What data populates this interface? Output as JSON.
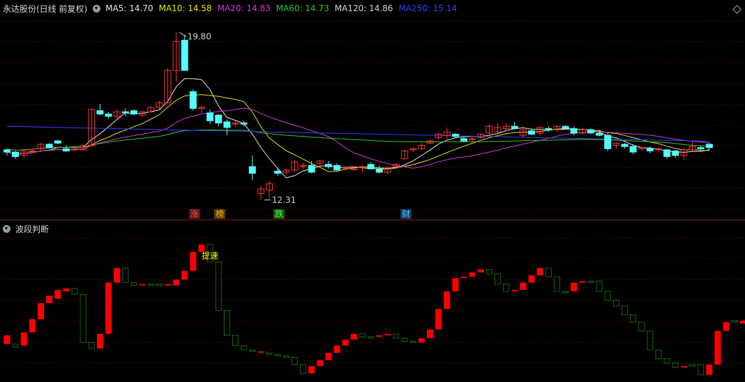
{
  "price_panel": {
    "title": "永达股份(日线 前复权)",
    "ma_legend": [
      {
        "label": "MA5: 14.70",
        "color": "#e8e8e8"
      },
      {
        "label": "MA10: 14.58",
        "color": "#e8e800"
      },
      {
        "label": "MA20: 14.83",
        "color": "#d23cd2"
      },
      {
        "label": "MA60: 14.73",
        "color": "#32c832"
      },
      {
        "label": "MA120: 14.86",
        "color": "#d8d8d8"
      },
      {
        "label": "MA250: 15.14",
        "color": "#3c3cff"
      }
    ],
    "high_label": "19.80",
    "low_label": "12.31",
    "markers": [
      {
        "text": "涨",
        "color": "#ff5050",
        "bg": "#5a1414"
      },
      {
        "text": "榜",
        "color": "#ffb000",
        "bg": "#5a3c00"
      },
      {
        "text": "跌",
        "color": "#50ff50",
        "bg": "#145a14"
      },
      {
        "text": "财",
        "color": "#50c8ff",
        "bg": "#143c5a"
      }
    ],
    "colors": {
      "up": "#ff3232",
      "down": "#54ffff",
      "grid": "#7a1010"
    }
  },
  "wave_panel": {
    "title": "波段判断",
    "annotation": "提速",
    "colors": {
      "up": "#ff0000",
      "down": "#22cc22"
    }
  },
  "chart_data": [
    {
      "type": "candlestick",
      "title": "永达股份(日线 前复权)",
      "ylim": [
        11.9,
        20.5
      ],
      "high": 19.8,
      "low": 12.31,
      "candles": [
        [
          14.55,
          14.6,
          14.3,
          14.45
        ],
        [
          14.45,
          14.5,
          14.15,
          14.25
        ],
        [
          14.3,
          14.55,
          14.2,
          14.5
        ],
        [
          14.5,
          14.6,
          14.4,
          14.5
        ],
        [
          14.6,
          14.85,
          14.45,
          14.8
        ],
        [
          14.8,
          14.85,
          14.6,
          14.65
        ],
        [
          14.95,
          15.0,
          14.8,
          14.85
        ],
        [
          14.6,
          14.75,
          14.45,
          14.5
        ],
        [
          14.55,
          14.65,
          14.5,
          14.6
        ],
        [
          14.55,
          14.8,
          14.5,
          14.75
        ],
        [
          14.75,
          16.4,
          14.7,
          16.35
        ],
        [
          16.3,
          16.6,
          16.1,
          16.15
        ],
        [
          16.15,
          16.25,
          15.95,
          16.05
        ],
        [
          16.05,
          16.35,
          15.95,
          16.25
        ],
        [
          16.25,
          16.4,
          16.05,
          16.2
        ],
        [
          16.3,
          16.35,
          16.1,
          16.15
        ],
        [
          16.1,
          16.3,
          16.0,
          16.25
        ],
        [
          16.25,
          16.5,
          16.2,
          16.45
        ],
        [
          16.45,
          16.75,
          16.35,
          16.65
        ],
        [
          16.65,
          18.2,
          16.6,
          18.1
        ],
        [
          18.1,
          19.8,
          17.6,
          19.4
        ],
        [
          19.45,
          19.7,
          18.1,
          18.1
        ],
        [
          17.15,
          17.25,
          16.3,
          16.4
        ],
        [
          16.4,
          16.5,
          16.2,
          16.45
        ],
        [
          16.2,
          16.35,
          15.7,
          15.85
        ],
        [
          16.1,
          16.15,
          15.6,
          15.75
        ],
        [
          15.8,
          15.9,
          15.2,
          15.55
        ],
        [
          15.7,
          15.85,
          15.6,
          15.75
        ],
        [
          15.75,
          15.85,
          15.6,
          15.7
        ],
        [
          13.8,
          14.3,
          13.2,
          13.5
        ],
        [
          12.6,
          12.95,
          12.31,
          12.8
        ],
        [
          12.75,
          13.15,
          12.4,
          13.05
        ],
        [
          13.6,
          13.75,
          13.4,
          13.5
        ],
        [
          13.55,
          13.7,
          13.45,
          13.65
        ],
        [
          13.65,
          14.1,
          13.55,
          14.0
        ],
        [
          13.8,
          13.95,
          13.7,
          13.85
        ],
        [
          13.85,
          14.05,
          13.5,
          13.55
        ],
        [
          13.95,
          14.1,
          13.8,
          14.05
        ],
        [
          13.9,
          14.05,
          13.7,
          13.8
        ],
        [
          13.85,
          13.95,
          13.6,
          13.65
        ],
        [
          13.75,
          13.85,
          13.65,
          13.75
        ],
        [
          13.7,
          13.8,
          13.6,
          13.7
        ],
        [
          13.75,
          13.85,
          13.55,
          13.8
        ],
        [
          13.9,
          14.0,
          13.7,
          13.7
        ],
        [
          13.7,
          13.85,
          13.5,
          13.55
        ],
        [
          13.55,
          13.8,
          13.45,
          13.75
        ],
        [
          13.8,
          13.95,
          13.7,
          13.9
        ],
        [
          14.15,
          14.55,
          14.1,
          14.5
        ],
        [
          14.55,
          14.65,
          14.45,
          14.6
        ],
        [
          14.6,
          14.85,
          14.55,
          14.75
        ],
        [
          14.85,
          15.0,
          14.8,
          14.95
        ],
        [
          15.1,
          15.3,
          15.0,
          15.25
        ],
        [
          15.2,
          15.55,
          14.95,
          15.35
        ],
        [
          15.25,
          15.3,
          15.1,
          15.15
        ],
        [
          15.05,
          15.1,
          14.9,
          14.95
        ],
        [
          15.0,
          15.1,
          14.9,
          15.05
        ],
        [
          15.1,
          15.3,
          15.05,
          15.25
        ],
        [
          15.3,
          15.7,
          15.2,
          15.6
        ],
        [
          15.35,
          15.75,
          15.3,
          15.55
        ],
        [
          15.5,
          15.75,
          15.4,
          15.6
        ],
        [
          15.6,
          15.8,
          15.45,
          15.5
        ],
        [
          15.2,
          15.6,
          15.1,
          15.45
        ],
        [
          15.4,
          15.5,
          15.2,
          15.25
        ],
        [
          15.3,
          15.6,
          15.2,
          15.55
        ],
        [
          15.5,
          15.6,
          15.35,
          15.45
        ],
        [
          15.45,
          15.65,
          15.35,
          15.6
        ],
        [
          15.6,
          15.65,
          15.45,
          15.5
        ],
        [
          15.5,
          15.6,
          15.2,
          15.3
        ],
        [
          15.3,
          15.55,
          15.25,
          15.45
        ],
        [
          15.45,
          15.5,
          15.25,
          15.3
        ],
        [
          15.3,
          15.45,
          15.15,
          15.2
        ],
        [
          15.2,
          15.3,
          14.5,
          14.6
        ],
        [
          14.75,
          14.9,
          14.6,
          14.85
        ],
        [
          14.8,
          14.85,
          14.6,
          14.7
        ],
        [
          14.7,
          14.8,
          14.35,
          14.45
        ],
        [
          14.6,
          14.7,
          14.5,
          14.65
        ],
        [
          14.6,
          14.7,
          14.4,
          14.5
        ],
        [
          14.55,
          14.65,
          14.45,
          14.6
        ],
        [
          14.55,
          14.6,
          14.15,
          14.25
        ],
        [
          14.5,
          14.55,
          14.2,
          14.3
        ],
        [
          14.3,
          14.65,
          14.1,
          14.55
        ],
        [
          14.55,
          14.95,
          14.5,
          14.7
        ],
        [
          14.65,
          14.75,
          14.55,
          14.6
        ],
        [
          14.8,
          14.85,
          14.55,
          14.65
        ]
      ]
    },
    {
      "type": "bar",
      "title": "波段判断",
      "ylim": [
        0,
        100
      ],
      "bars": [
        [
          30,
          24,
          "up"
        ],
        [
          24,
          22,
          "down"
        ],
        [
          23,
          32,
          "up"
        ],
        [
          32,
          41,
          "up"
        ],
        [
          41,
          52,
          "up"
        ],
        [
          52,
          57,
          "up"
        ],
        [
          55,
          61,
          "up"
        ],
        [
          60,
          62,
          "up"
        ],
        [
          62,
          58,
          "down"
        ],
        [
          58,
          25,
          "down"
        ],
        [
          25,
          21,
          "down"
        ],
        [
          21,
          31,
          "up"
        ],
        [
          31,
          66,
          "up"
        ],
        [
          66,
          76,
          "up"
        ],
        [
          76,
          66,
          "down"
        ],
        [
          66,
          64,
          "down"
        ],
        [
          64,
          65,
          "up"
        ],
        [
          65,
          65,
          "down"
        ],
        [
          65,
          65,
          "down"
        ],
        [
          65,
          64,
          "up"
        ],
        [
          64,
          68,
          "up"
        ],
        [
          68,
          74,
          "up"
        ],
        [
          74,
          87,
          "up"
        ],
        [
          87,
          92,
          "up"
        ],
        [
          92,
          80,
          "down"
        ],
        [
          80,
          47,
          "down"
        ],
        [
          47,
          30,
          "down"
        ],
        [
          30,
          23,
          "down"
        ],
        [
          23,
          20,
          "down"
        ],
        [
          20,
          19,
          "down"
        ],
        [
          19,
          18,
          "up"
        ],
        [
          18,
          17,
          "down"
        ],
        [
          17,
          16,
          "down"
        ],
        [
          16,
          15,
          "down"
        ],
        [
          15,
          10,
          "down"
        ],
        [
          10,
          4,
          "down"
        ],
        [
          4,
          9,
          "up"
        ],
        [
          9,
          13,
          "up"
        ],
        [
          13,
          18,
          "up"
        ],
        [
          18,
          23,
          "up"
        ],
        [
          23,
          27,
          "up"
        ],
        [
          27,
          31,
          "up"
        ],
        [
          31,
          29,
          "down"
        ],
        [
          29,
          29,
          "down"
        ],
        [
          29,
          30,
          "up"
        ],
        [
          30,
          31,
          "up"
        ],
        [
          31,
          28,
          "down"
        ],
        [
          28,
          26,
          "down"
        ],
        [
          26,
          25,
          "down"
        ],
        [
          25,
          28,
          "up"
        ],
        [
          28,
          34,
          "up"
        ],
        [
          34,
          48,
          "up"
        ],
        [
          48,
          60,
          "up"
        ],
        [
          60,
          69,
          "up"
        ],
        [
          69,
          70,
          "up"
        ],
        [
          70,
          73,
          "up"
        ],
        [
          73,
          75,
          "up"
        ],
        [
          75,
          72,
          "down"
        ],
        [
          72,
          65,
          "down"
        ],
        [
          65,
          60,
          "down"
        ],
        [
          60,
          61,
          "up"
        ],
        [
          61,
          66,
          "up"
        ],
        [
          66,
          71,
          "up"
        ],
        [
          71,
          76,
          "up"
        ],
        [
          76,
          70,
          "down"
        ],
        [
          70,
          60,
          "down"
        ],
        [
          60,
          60,
          "down"
        ],
        [
          60,
          66,
          "up"
        ],
        [
          66,
          67,
          "up"
        ],
        [
          67,
          67,
          "down"
        ],
        [
          67,
          60,
          "down"
        ],
        [
          60,
          54,
          "down"
        ],
        [
          54,
          50,
          "down"
        ],
        [
          50,
          44,
          "down"
        ],
        [
          44,
          39,
          "down"
        ],
        [
          39,
          33,
          "down"
        ],
        [
          33,
          20,
          "down"
        ],
        [
          20,
          14,
          "down"
        ],
        [
          14,
          11,
          "down"
        ],
        [
          11,
          8,
          "down"
        ],
        [
          8,
          9,
          "up"
        ],
        [
          9,
          10,
          "down"
        ],
        [
          10,
          3,
          "down"
        ],
        [
          3,
          10,
          "up"
        ],
        [
          10,
          33,
          "up"
        ],
        [
          33,
          39,
          "up"
        ],
        [
          39,
          40,
          "down"
        ],
        [
          40,
          38,
          "up"
        ]
      ]
    }
  ]
}
